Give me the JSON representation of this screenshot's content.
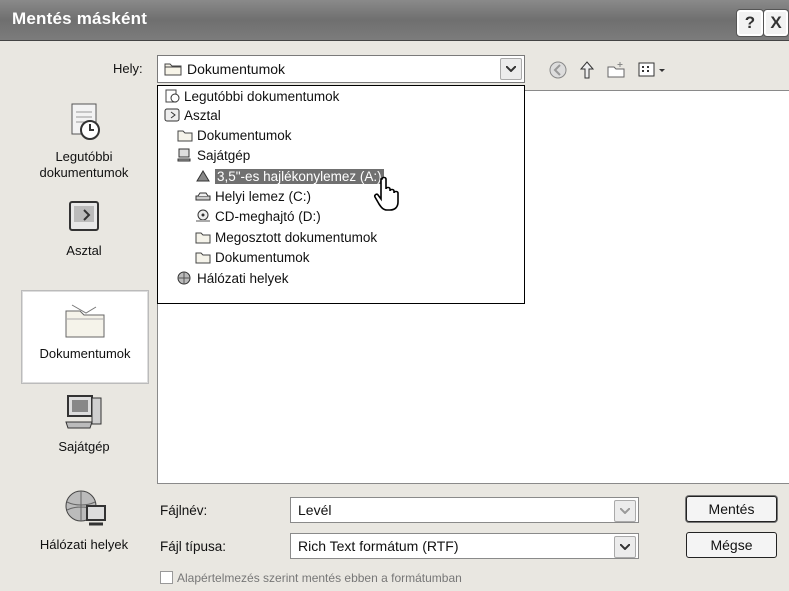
{
  "window": {
    "title": "Mentés másként",
    "help_label": "?",
    "close_label": "X"
  },
  "location": {
    "label": "Hely:",
    "value": "Dokumentumok"
  },
  "toolbar": {
    "icons": [
      "back-icon",
      "up-folder-icon",
      "new-folder-icon",
      "views-menu-icon"
    ]
  },
  "dropdown": {
    "items": [
      {
        "label": "Legutóbbi dokumentumok",
        "icon": "recent-docs-icon"
      },
      {
        "label": "Asztal",
        "icon": "desktop-icon"
      },
      {
        "label": "Dokumentumok",
        "icon": "folder-icon"
      },
      {
        "label": "Sajátgép",
        "icon": "computer-icon"
      },
      {
        "label": "3,5\"-es hajlékonylemez (A:)",
        "icon": "floppy-icon",
        "selected": true
      },
      {
        "label": "Helyi lemez (C:)",
        "icon": "hard-disk-icon"
      },
      {
        "label": "CD-meghajtó (D:)",
        "icon": "cd-drive-icon"
      },
      {
        "label": "Megosztott dokumentumok",
        "icon": "folder-icon"
      },
      {
        "label": "Dokumentumok",
        "icon": "folder-icon"
      },
      {
        "label": "Hálózati helyek",
        "icon": "network-icon"
      }
    ]
  },
  "places": {
    "items": [
      {
        "label": "Legutóbbi dokumentumok",
        "icon": "recent-docs-icon"
      },
      {
        "label": "Asztal",
        "icon": "desktop-icon"
      },
      {
        "label": "Dokumentumok",
        "icon": "my-documents-icon",
        "selected": true
      },
      {
        "label": "Sajátgép",
        "icon": "my-computer-icon"
      },
      {
        "label": "Hálózati helyek",
        "icon": "network-places-icon"
      }
    ]
  },
  "filename": {
    "label": "Fájlnév:",
    "value": "Levél"
  },
  "filetype": {
    "label": "Fájl típusa:",
    "value": "Rich Text formátum (RTF)"
  },
  "buttons": {
    "save": "Mentés",
    "cancel": "Mégse"
  },
  "default_format": {
    "label": "Alapértelmezés szerint mentés ebben a formátumban",
    "checked": true
  }
}
